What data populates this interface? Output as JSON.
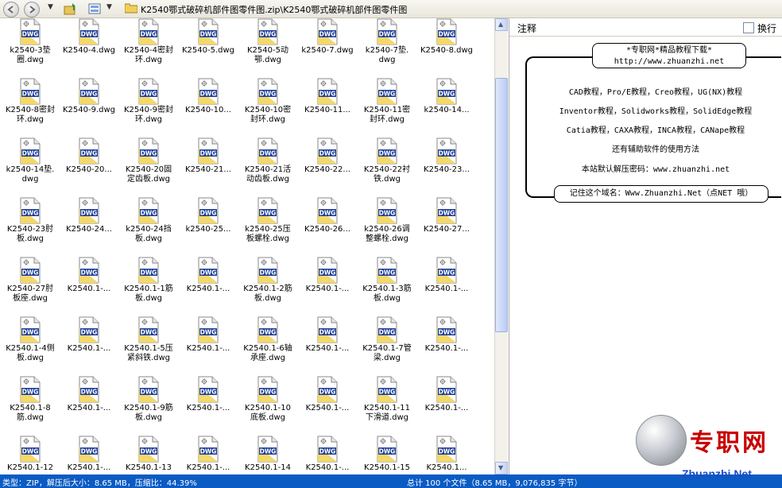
{
  "toolbar": {
    "path": "K2540鄂式破碎机部件图零件图.zip\\K2540鄂式破碎机部件图零件图"
  },
  "icon_names": {
    "back": "back-arrow-icon",
    "forward": "forward-arrow-icon",
    "up": "folder-up-icon",
    "view": "view-mode-icon",
    "folder": "folder-icon",
    "file": "dwg-file-icon"
  },
  "colors": {
    "statusbar": "#0a5bc4",
    "dwg_badge": "#1f3f98",
    "dwg_fill": "#f3d86a",
    "watermark_red": "#c80000",
    "watermark_blue": "#1a4cc8"
  },
  "files": [
    "k2540-3垫\n圈.dwg",
    "K2540-4.dwg",
    "K2540-4密封\n环.dwg",
    "K2540-5.dwg",
    "K2540-5动\n鄂.dwg",
    "k2540-7.dwg",
    "k2540-7垫.\ndwg",
    "K2540-8.dwg",
    "K2540-8密封\n环.dwg",
    "K2540-9.dwg",
    "K2540-9密封\n环.dwg",
    "K2540-10...",
    "K2540-10密\n封环.dwg",
    "K2540-11...",
    "K2540-11密\n封环.dwg",
    "k2540-14...",
    "k2540-14垫.\ndwg",
    "K2540-20...",
    "K2540-20固\n定齿板.dwg",
    "K2540-21...",
    "K2540-21活\n动齿板.dwg",
    "K2540-22...",
    "K2540-22衬\n铁.dwg",
    "K2540-23...",
    "K2540-23肘\n板.dwg",
    "K2540-24...",
    "k2540-24挡\n板.dwg",
    "k2540-25...",
    "k2540-25压\n板螺栓.dwg",
    "K2540-26...",
    "k2540-26调\n整螺栓.dwg",
    "K2540-27...",
    "K2540-27肘\n板座.dwg",
    "K2540.1-...",
    "K2540.1-1筋\n板.dwg",
    "K2540.1-...",
    "K2540.1-2筋\n板.dwg",
    "K2540.1-...",
    "K2540.1-3筋\n板.dwg",
    "K2540.1-...",
    "K2540.1-4侧\n板.dwg",
    "K2540.1-...",
    "K2540.1-5压\n紧斜铁.dwg",
    "K2540.1-...",
    "K2540.1-6轴\n承座.dwg",
    "K2540.1-...",
    "K2540.1-7管\n梁.dwg",
    "K2540.1-...",
    "K2540.1-8\n筋.dwg",
    "K2540.1-...",
    "K2540.1-9筋\n板.dwg",
    "K2540.1-...",
    "K2540.1-10\n底板.dwg",
    "K2540.1-...",
    "K2540.1-11\n下滑道.dwg",
    "K2540.1-...",
    "K2540.1-12",
    "K2540.1-...",
    "K2540.1-13",
    "K2540.1-...",
    "K2540.1-14",
    "K2540.1-...",
    "K2540.1-15",
    "K2540.1..."
  ],
  "notes": {
    "title": "注释",
    "wrap_label": "换行",
    "banner_line1": "*专职网*精品教程下载*",
    "banner_line2": "http://www.zhuanzhi.net",
    "lines": [
      "CAD教程，Pro/E教程，Creo教程，UG(NX)教程",
      "Inventor教程，Solidworks教程，SolidEdge教程",
      "Catia教程，CAXA教程，INCA教程，CANape教程",
      "还有辅助软件的使用方法",
      "本站默认解压密码：www.zhuanzhi.net"
    ],
    "footer": "记住这个域名：Www.Zhuanzhi.Net（点NET 哦）"
  },
  "status": {
    "left": "类型：ZIP，解压后大小：8.65 MB，压缩比：44.39%",
    "right": "总计 100 个文件（8.65 MB，9,076,835 字节）"
  },
  "watermark": {
    "text": "专职网",
    "url": "Zhuanzhi.Net"
  }
}
